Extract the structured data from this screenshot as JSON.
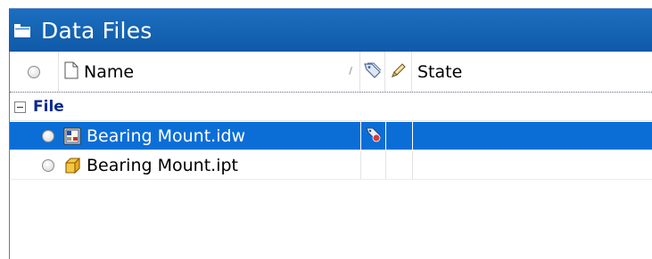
{
  "panel": {
    "title": "Data Files",
    "title_icon": "folder-icon"
  },
  "columns": {
    "select_icon": "radio-icon",
    "type_icon": "document-icon",
    "name_label": "Name",
    "sort_indicator": "/",
    "checkout_icon": "tag-icon",
    "edit_icon": "pencil-icon",
    "state_label": "State"
  },
  "groups": [
    {
      "label": "File",
      "expanded": true,
      "rows": [
        {
          "name": "Bearing Mount.idw",
          "type_icon": "drawing-icon",
          "status_icon": "checked-out-tag-icon",
          "state": "",
          "selected": true
        },
        {
          "name": "Bearing Mount.ipt",
          "type_icon": "part-icon",
          "status_icon": "",
          "state": "",
          "selected": false
        }
      ]
    }
  ],
  "colors": {
    "title_bar": "#1565b8",
    "selection": "#0b6ed6",
    "group_label": "#0b2a8c"
  }
}
